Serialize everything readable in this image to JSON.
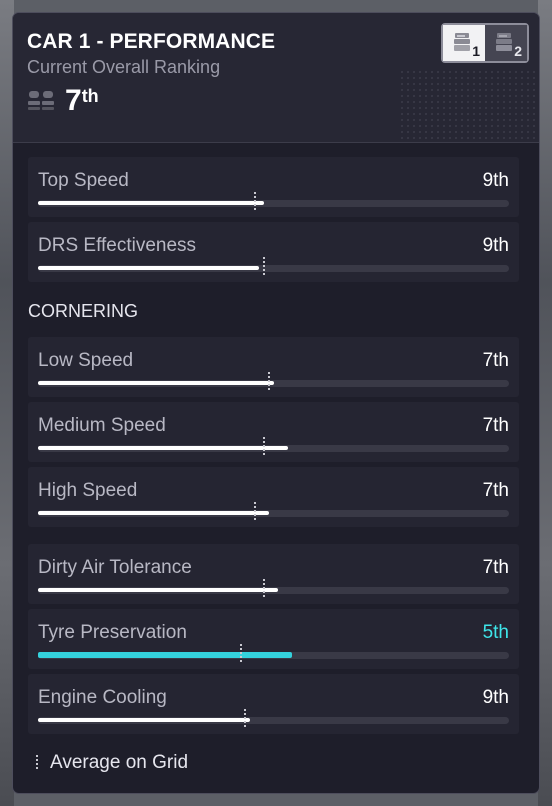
{
  "header": {
    "title": "CAR 1 - PERFORMANCE",
    "subtitle": "Current Overall Ranking",
    "rank_number": "7",
    "rank_suffix": "th",
    "rank_icon": "team-cars-icon"
  },
  "car_switch": {
    "options": [
      {
        "label": "1",
        "icon": "car-garage-icon",
        "active": true
      },
      {
        "label": "2",
        "icon": "car-garage-icon",
        "active": false
      }
    ]
  },
  "groups": [
    {
      "heading": "",
      "rows": [
        {
          "label": "Top Speed",
          "rank": "9th",
          "value": 0.48,
          "average": 0.46,
          "highlight": false
        },
        {
          "label": "DRS Effectiveness",
          "rank": "9th",
          "value": 0.47,
          "average": 0.48,
          "highlight": false
        }
      ]
    },
    {
      "heading": "CORNERING",
      "rows": [
        {
          "label": "Low Speed",
          "rank": "7th",
          "value": 0.5,
          "average": 0.49,
          "highlight": false
        },
        {
          "label": "Medium Speed",
          "rank": "7th",
          "value": 0.53,
          "average": 0.48,
          "highlight": false
        },
        {
          "label": "High Speed",
          "rank": "7th",
          "value": 0.49,
          "average": 0.46,
          "highlight": false
        }
      ]
    },
    {
      "heading": "",
      "rows": [
        {
          "label": "Dirty Air Tolerance",
          "rank": "7th",
          "value": 0.51,
          "average": 0.48,
          "highlight": false
        },
        {
          "label": "Tyre Preservation",
          "rank": "5th",
          "value": 0.54,
          "average": 0.43,
          "highlight": true
        },
        {
          "label": "Engine Cooling",
          "rank": "9th",
          "value": 0.45,
          "average": 0.44,
          "highlight": false
        }
      ]
    }
  ],
  "legend": {
    "label": "Average on Grid"
  },
  "colors": {
    "panel": "#1e1e2a",
    "row": "#252532",
    "accent": "#34d2dd",
    "bar": "#ffffff"
  }
}
